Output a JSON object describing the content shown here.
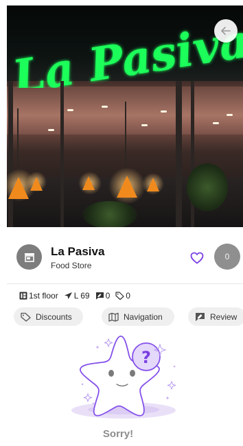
{
  "store": {
    "name": "La Pasiva",
    "category": "Food Store",
    "sign_text": "La Pasiva",
    "like_count": "0"
  },
  "info": {
    "floor": "1st floor",
    "location": "L 69",
    "comments": "0",
    "discounts": "0"
  },
  "chips": {
    "discounts": "Discounts",
    "navigation": "Navigation",
    "review": "Review"
  },
  "empty_state": {
    "title": "Sorry!"
  },
  "colors": {
    "accent": "#7b3fe4",
    "neon_sign": "#1fff5a",
    "chip_bg": "#efefef",
    "avatar_bg": "#7d7d7d"
  },
  "icons": [
    "back-arrow-icon",
    "store-icon",
    "heart-outline-icon",
    "floor-icon",
    "location-arrow-icon",
    "comment-icon",
    "tag-icon",
    "map-icon",
    "review-icon",
    "question-star-illustration"
  ]
}
